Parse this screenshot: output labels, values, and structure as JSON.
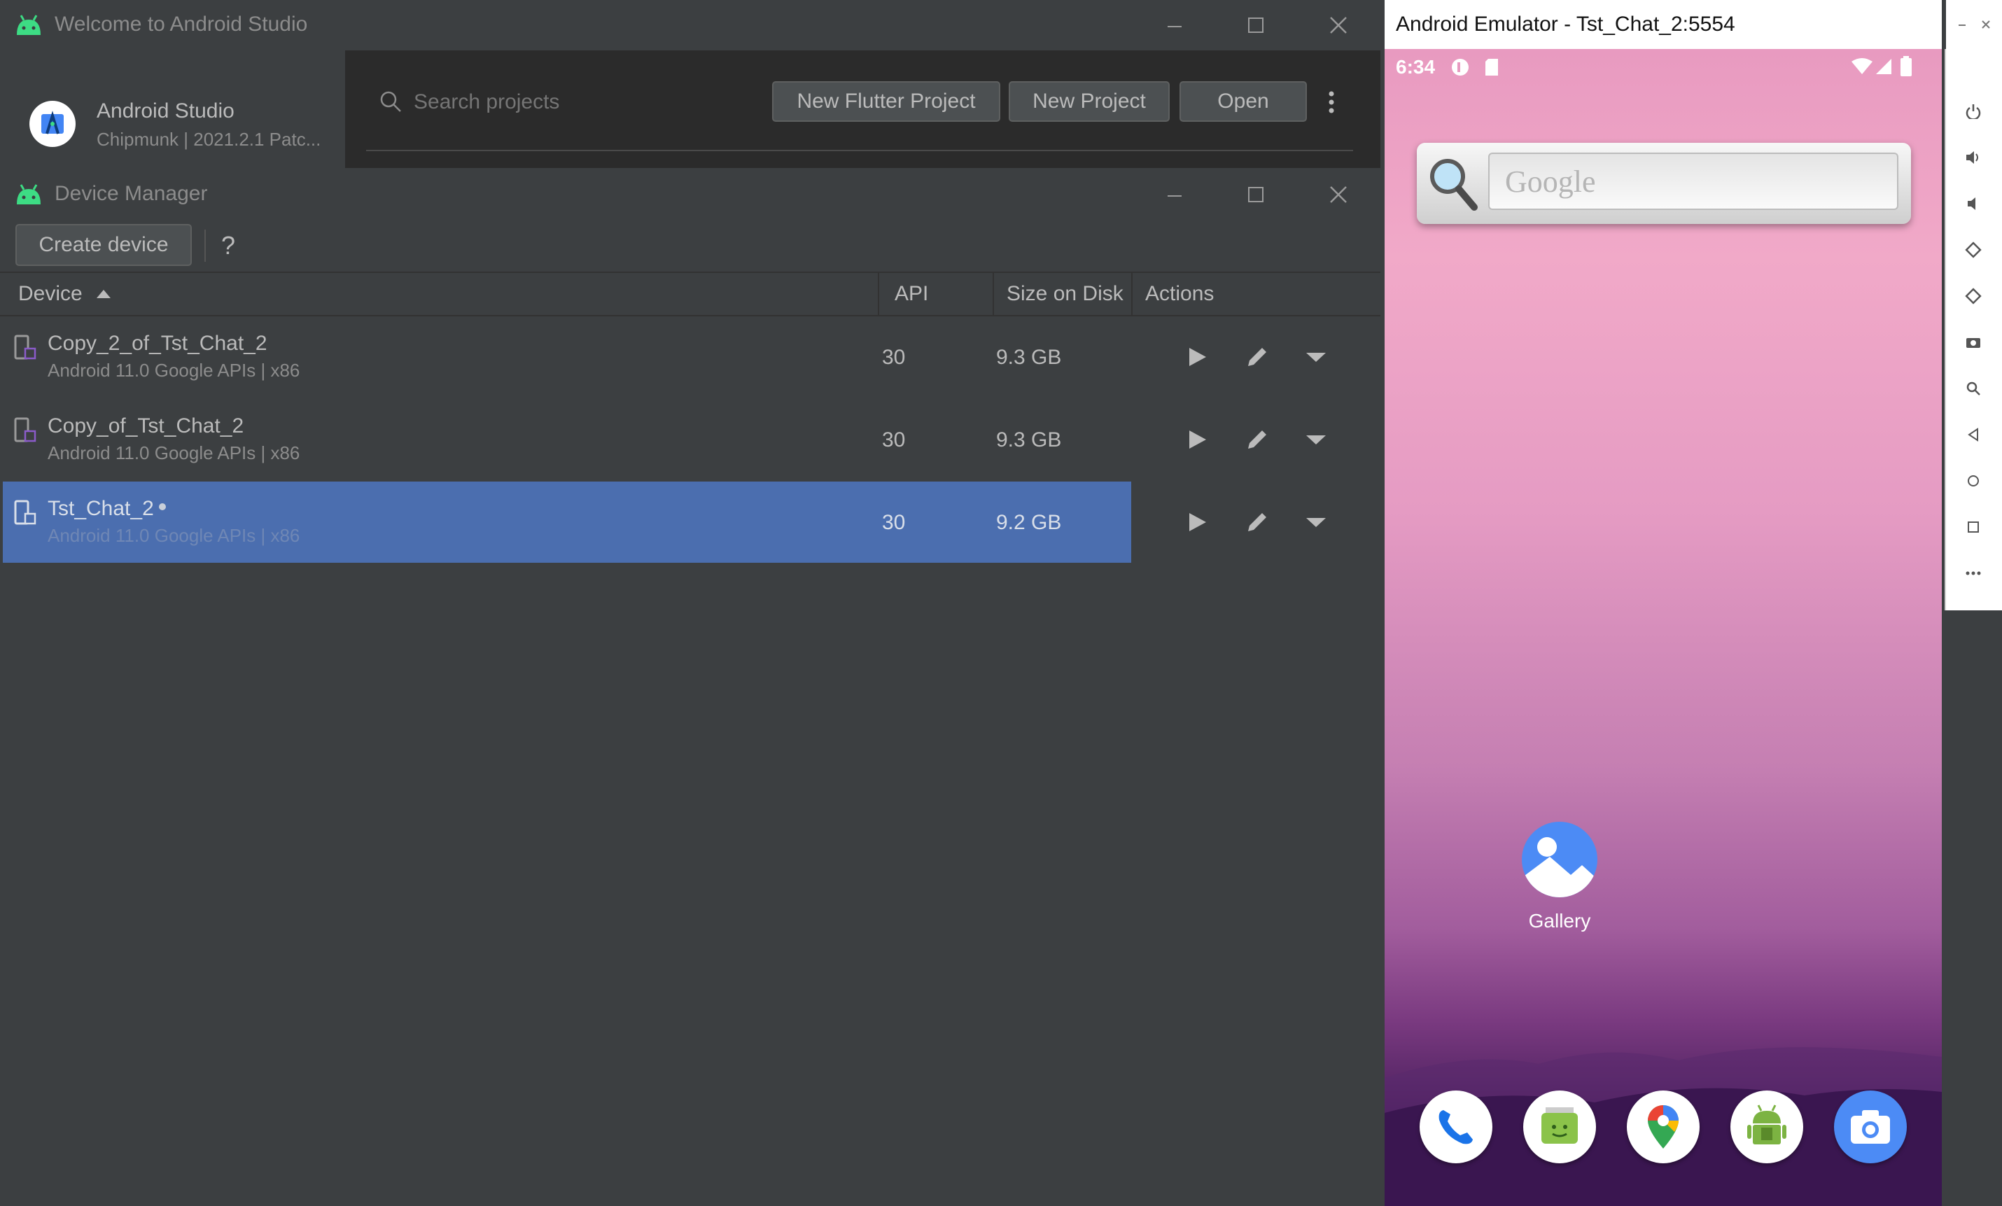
{
  "welcome": {
    "title": "Welcome to Android Studio",
    "app_name": "Android Studio",
    "app_version": "Chipmunk | 2021.2.1 Patc...",
    "search_placeholder": "Search projects",
    "buttons": {
      "new_flutter": "New Flutter Project",
      "new_project": "New Project",
      "open": "Open"
    }
  },
  "device_manager": {
    "title": "Device Manager",
    "create_device": "Create device",
    "help": "?",
    "columns": {
      "device": "Device",
      "api": "API",
      "size": "Size on Disk",
      "actions": "Actions"
    },
    "rows": [
      {
        "name": "Copy_2_of_Tst_Chat_2",
        "detail": "Android 11.0 Google APIs | x86",
        "api": "30",
        "size": "9.3 GB",
        "running": false
      },
      {
        "name": "Copy_of_Tst_Chat_2",
        "detail": "Android 11.0 Google APIs | x86",
        "api": "30",
        "size": "9.3 GB",
        "running": false
      },
      {
        "name": "Tst_Chat_2",
        "detail": "Android 11.0 Google APIs | x86",
        "api": "30",
        "size": "9.2 GB",
        "running": true,
        "selected": true
      }
    ]
  },
  "emulator": {
    "title": "Android Emulator - Tst_Chat_2:5554",
    "status_time": "6:34",
    "search_widget_text": "Google",
    "desktop_icon_label": "Gallery",
    "dock": [
      "phone-icon",
      "messages-icon",
      "maps-icon",
      "android-app-icon",
      "camera-icon"
    ],
    "side_controls": [
      "power-icon",
      "volume-up-icon",
      "volume-down-icon",
      "rotate-left-icon",
      "rotate-right-icon",
      "screenshot-icon",
      "zoom-icon",
      "back-icon",
      "home-icon",
      "overview-icon",
      "more-icon"
    ]
  },
  "colors": {
    "selection": "#4b6eaf",
    "android_green": "#3ddc84",
    "panel": "#3c3f41"
  }
}
